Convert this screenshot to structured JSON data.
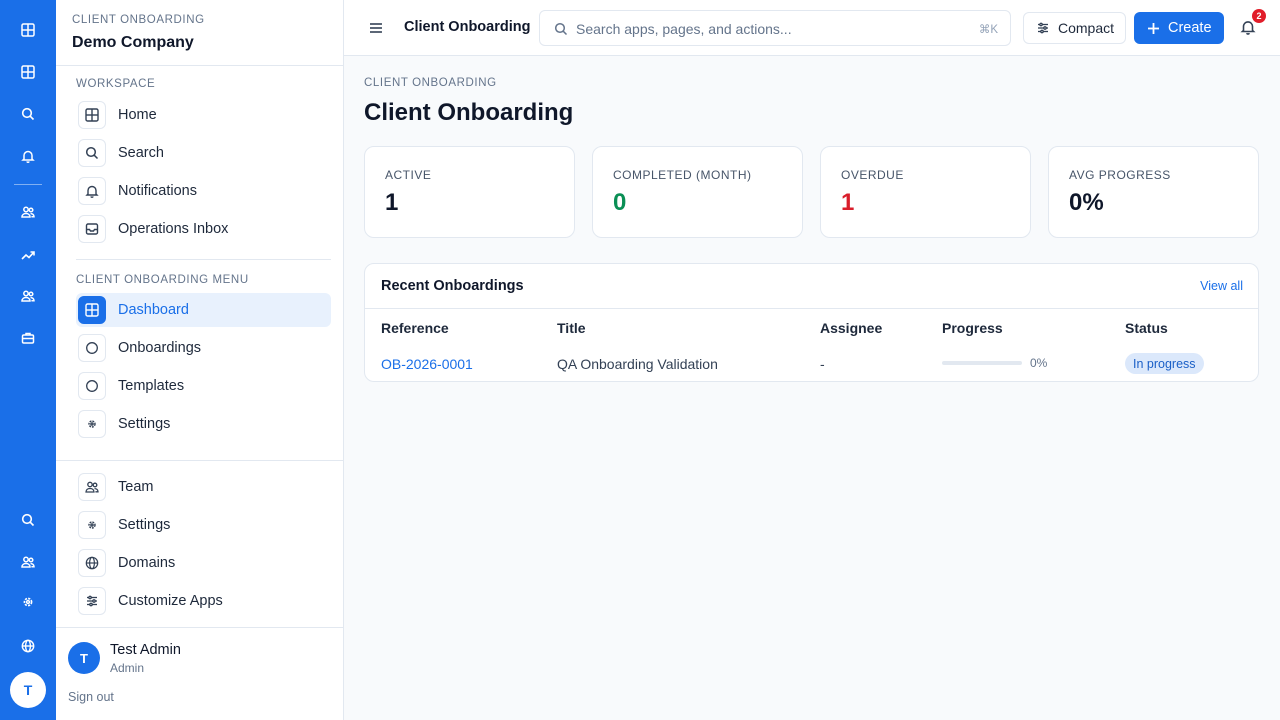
{
  "rail": {
    "avatar_initial": "T",
    "icons_top": [
      "grid-icon",
      "grid-icon",
      "search-icon",
      "bell-icon"
    ],
    "icons_mid": [
      "users-icon",
      "trending-icon",
      "users-icon",
      "briefcase-icon"
    ],
    "icons_bottom": [
      "search-icon",
      "users-icon",
      "settings-icon",
      "globe-icon"
    ]
  },
  "sidebar": {
    "app_label": "CLIENT ONBOARDING",
    "company": "Demo Company",
    "workspace_label": "WORKSPACE",
    "workspace_items": [
      {
        "label": "Home",
        "icon": "grid-icon"
      },
      {
        "label": "Search",
        "icon": "search-icon"
      },
      {
        "label": "Notifications",
        "icon": "bell-icon"
      },
      {
        "label": "Operations Inbox",
        "icon": "inbox-icon"
      }
    ],
    "menu_label": "CLIENT ONBOARDING MENU",
    "menu_items": [
      {
        "label": "Dashboard",
        "icon": "grid-icon",
        "active": true
      },
      {
        "label": "Onboardings",
        "icon": "circle-icon"
      },
      {
        "label": "Templates",
        "icon": "circle-icon"
      },
      {
        "label": "Settings",
        "icon": "settings-icon"
      }
    ],
    "admin_items": [
      {
        "label": "Team",
        "icon": "users-icon"
      },
      {
        "label": "Settings",
        "icon": "settings-icon"
      },
      {
        "label": "Domains",
        "icon": "globe-icon"
      },
      {
        "label": "Customize Apps",
        "icon": "sliders-icon"
      }
    ],
    "user": {
      "initial": "T",
      "name": "Test Admin",
      "role": "Admin"
    },
    "sign_out": "Sign out"
  },
  "topbar": {
    "title": "Client Onboarding",
    "search_placeholder": "Search apps, pages, and actions...",
    "search_shortcut": "⌘K",
    "compact_label": "Compact",
    "create_label": "Create",
    "notification_count": "2"
  },
  "main": {
    "breadcrumb": "CLIENT ONBOARDING",
    "title": "Client Onboarding",
    "stats": [
      {
        "label": "ACTIVE",
        "value": "1",
        "color": "#0f172a"
      },
      {
        "label": "COMPLETED (MONTH)",
        "value": "0",
        "color": "#0a8f55"
      },
      {
        "label": "OVERDUE",
        "value": "1",
        "color": "#d91e2b"
      },
      {
        "label": "AVG PROGRESS",
        "value": "0%",
        "color": "#0f172a"
      }
    ],
    "recent": {
      "title": "Recent Onboardings",
      "view_all": "View all",
      "columns": [
        "Reference",
        "Title",
        "Assignee",
        "Progress",
        "Status"
      ],
      "rows": [
        {
          "reference": "OB-2026-0001",
          "title": "QA Onboarding Validation",
          "assignee": "-",
          "progress": 0,
          "progress_text": "0%",
          "status": "In progress"
        }
      ]
    }
  },
  "colors": {
    "accent": "#1a6fe8",
    "success": "#0a8f55",
    "danger": "#d91e2b",
    "badge": "#e11d2a"
  }
}
